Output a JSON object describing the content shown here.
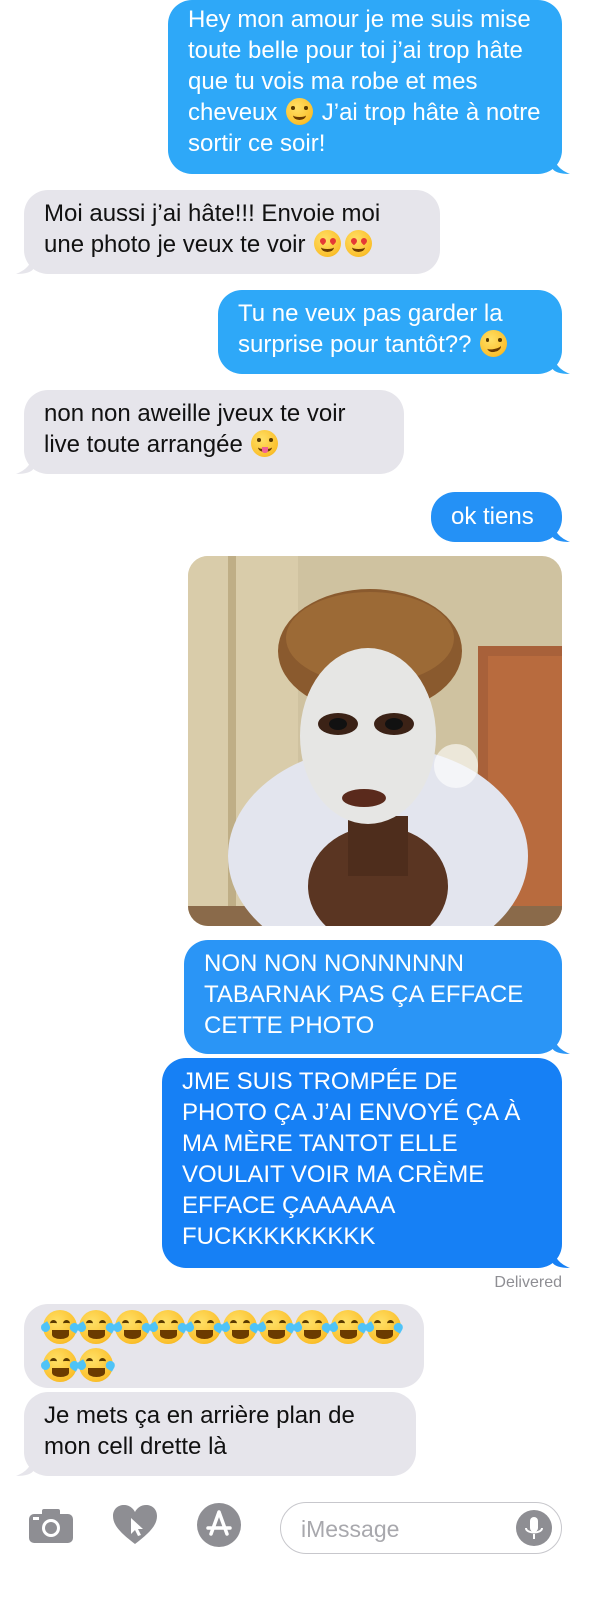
{
  "colors": {
    "outgoing_light": "#2ea8f8",
    "outgoing_dark": "#1680f5",
    "incoming": "#e6e5eb",
    "status_text": "#8e8e93",
    "toolbar_icon": "#8e8e93"
  },
  "messages": [
    {
      "direction": "outgoing",
      "text_before": "Hey mon amour je me suis mise toute belle pour toi j’ai trop hâte que tu vois ma robe et mes cheveux",
      "emoji": "smiling-face-icon",
      "text_after": " J’ai trop hâte à notre sortir ce soir!"
    },
    {
      "direction": "incoming",
      "text_before": "Moi aussi j’ai hâte!!! Envoie moi une photo je veux te voir",
      "emoji": "heart-eyes-face-icon x2"
    },
    {
      "direction": "outgoing",
      "text_before": "Tu ne veux pas garder la surprise pour tantôt??",
      "emoji": "smirking-face-icon"
    },
    {
      "direction": "incoming",
      "text_before": "non non aweille jveux te voir live toute arrangée",
      "emoji": "tongue-face-icon"
    },
    {
      "direction": "outgoing",
      "text": "ok tiens"
    },
    {
      "direction": "outgoing",
      "type": "photo",
      "content": "selfie-with-face-mask"
    },
    {
      "direction": "outgoing",
      "text": "NON NON NONNNNNN TABARNAK PAS ÇA EFFACE CETTE PHOTO"
    },
    {
      "direction": "outgoing",
      "text": "JME SUIS TROMPÉE DE PHOTO ÇA J’AI ENVOYÉ ÇA À MA MÈRE TANTOT ELLE VOULAIT VOIR MA CRÈME EFFACE ÇAAAAAA FUCKKKKKKKKK"
    },
    {
      "direction": "incoming",
      "type": "emoji-only",
      "emoji": "face-with-tears-of-joy-icon",
      "count": 12
    },
    {
      "direction": "incoming",
      "text": "Je mets ça en arrière plan de mon cell drette là"
    }
  ],
  "status": {
    "delivered": "Delivered"
  },
  "toolbar": {
    "camera": "camera-icon",
    "digital_touch": "digital-touch-heart-icon",
    "app_store": "app-store-icon",
    "input_placeholder": "iMessage",
    "mic": "microphone-icon"
  }
}
